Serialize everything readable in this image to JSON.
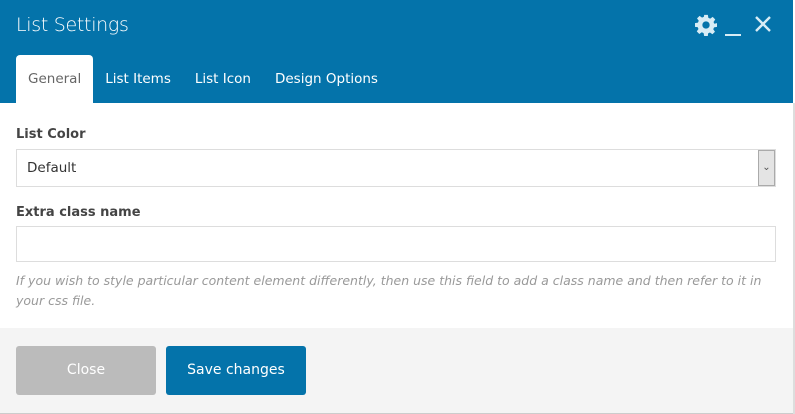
{
  "header": {
    "title": "List Settings",
    "icons": [
      "gear-icon",
      "minimize-icon",
      "close-icon"
    ]
  },
  "tabs": [
    {
      "label": "General",
      "active": true
    },
    {
      "label": "List Items"
    },
    {
      "label": "List Icon"
    },
    {
      "label": "Design Options"
    }
  ],
  "fields": {
    "list_color": {
      "label": "List Color",
      "value": "Default"
    },
    "extra_class": {
      "label": "Extra class name",
      "value": "",
      "help": "If you wish to style particular content element differently, then use this field to add a class name and then refer to it in your css file."
    }
  },
  "footer": {
    "close_label": "Close",
    "save_label": "Save changes"
  },
  "colors": {
    "accent": "#0473aa",
    "close_button": "#bbbbbb"
  }
}
